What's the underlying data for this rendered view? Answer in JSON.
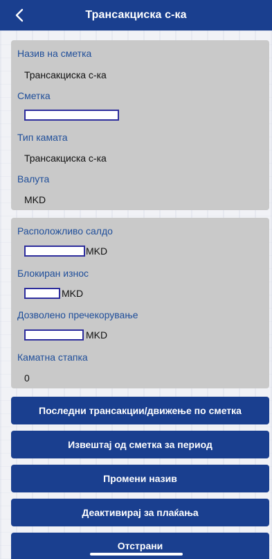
{
  "header": {
    "title": "Трансакциска с-ка",
    "back_icon": "chevron-left-icon"
  },
  "account_info": {
    "name_label": "Назив на сметка",
    "name_value": "Трансакциска с-ка",
    "account_label": "Сметка",
    "interest_type_label": "Тип камата",
    "interest_type_value": "Трансакциска с-ка",
    "currency_label": "Валута",
    "currency_value": "MKD"
  },
  "balances": {
    "available_label": "Расположливо салдо",
    "available_currency": "MKD",
    "blocked_label": "Блокиран износ",
    "blocked_currency": "MKD",
    "overdraft_label": "Дозволено пречекорување",
    "overdraft_currency": "MKD",
    "interest_rate_label": "Каматна стапка",
    "interest_rate_value": "0"
  },
  "actions": {
    "last_transactions": "Последни трансакции/движење по сметка",
    "statement": "Извештај од сметка за период",
    "rename": "Промени назив",
    "deactivate": "Деактивирај за плаќања",
    "remove": "Отстрани"
  },
  "colors": {
    "primary": "#1a3f8f",
    "label_blue": "#1f4e9a",
    "card_grey": "#c9c9c9"
  }
}
